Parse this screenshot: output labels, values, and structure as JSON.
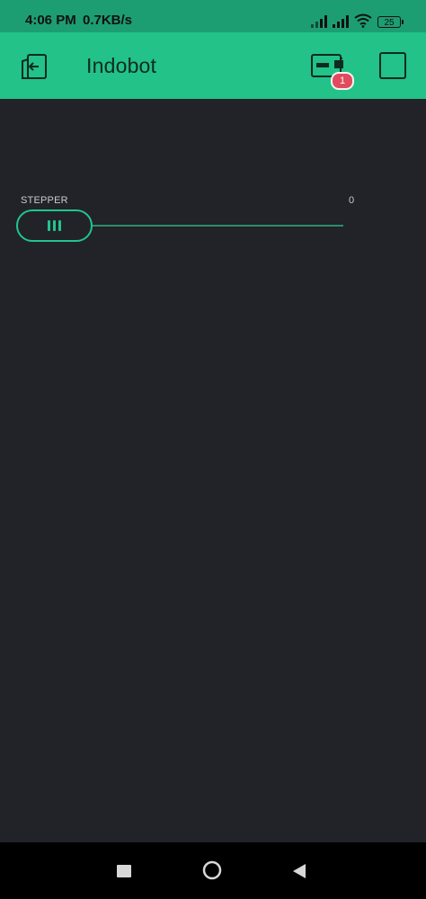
{
  "status_bar": {
    "time": "4:06 PM",
    "net_speed": "0.7KB/s",
    "battery": "25",
    "icons": [
      "signal-icon",
      "signal-icon",
      "wifi-icon",
      "battery-icon"
    ]
  },
  "header": {
    "title": "Indobot",
    "device_badge_count": "1",
    "icons": [
      "exit-icon",
      "device-icon",
      "square-icon"
    ]
  },
  "widget": {
    "label": "STEPPER",
    "value": "0",
    "level": 0
  },
  "nav_bar": {
    "icons": [
      "recent-apps-icon",
      "home-icon",
      "back-icon"
    ]
  },
  "colors": {
    "header_bg": "#22c288",
    "status_bg": "#1c9e72",
    "canvas_bg": "#212328",
    "accent": "#23c48e",
    "badge": "#e24a5e"
  }
}
